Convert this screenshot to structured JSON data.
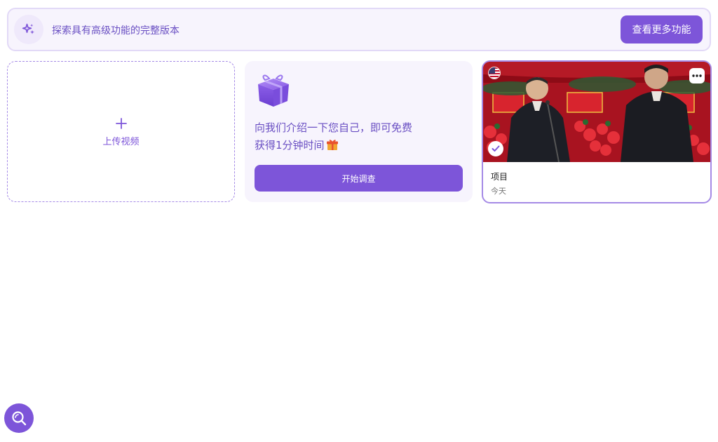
{
  "banner": {
    "icon": "sparkles-icon",
    "text": "探索具有高级功能的完整版本",
    "button_label": "查看更多功能"
  },
  "upload": {
    "icon": "plus-icon",
    "label": "上传视频"
  },
  "survey": {
    "icon": "gift-box-icon",
    "line1": "向我们介绍一下您自己，即可免费",
    "line2": "获得1分钟时间",
    "line2_icon": "gift-emoji-icon",
    "button_label": "开始调查"
  },
  "project": {
    "thumbnail": "video-thumbnail",
    "flag": "us-flag-icon",
    "more_icon": "more-dots-icon",
    "check_icon": "check-icon",
    "title": "项目",
    "date": "今天"
  },
  "fab": {
    "icon": "search-icon"
  },
  "colors": {
    "accent": "#7d55d9",
    "accent_text": "#6a4fc3",
    "card_bg": "#f7f4fd",
    "border": "#e2d9f7"
  }
}
